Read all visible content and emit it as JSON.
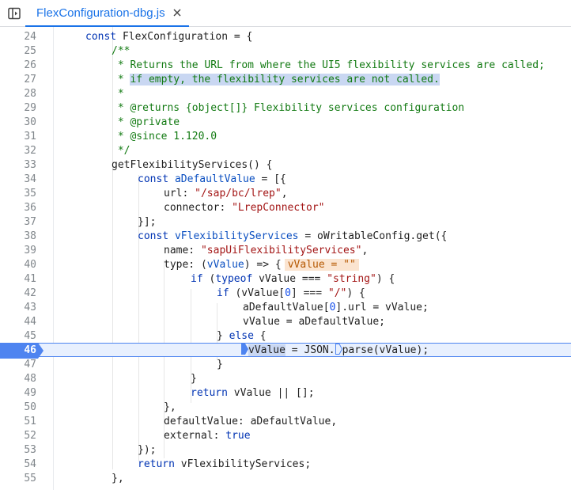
{
  "tab": {
    "filename": "FlexConfiguration-dbg.js"
  },
  "icons": {
    "sidebar_toggle": "sidebar-toggle-icon",
    "close": "close-icon",
    "breakpoint": "breakpoint-marker-icon"
  },
  "colors": {
    "accent": "#1a73e8",
    "active_line": "#e8f0fe",
    "breakpoint": "#4e84f0",
    "inline_value_bg": "#fbe4d0"
  },
  "editor": {
    "active_line": "46",
    "lines": [
      {
        "n": "24"
      },
      {
        "n": "25"
      },
      {
        "n": "26"
      },
      {
        "n": "27"
      },
      {
        "n": "28"
      },
      {
        "n": "29"
      },
      {
        "n": "30"
      },
      {
        "n": "31"
      },
      {
        "n": "32"
      },
      {
        "n": "33"
      },
      {
        "n": "34"
      },
      {
        "n": "35"
      },
      {
        "n": "36"
      },
      {
        "n": "37"
      },
      {
        "n": "38"
      },
      {
        "n": "39"
      },
      {
        "n": "40"
      },
      {
        "n": "41"
      },
      {
        "n": "42"
      },
      {
        "n": "43"
      },
      {
        "n": "44"
      },
      {
        "n": "45"
      },
      {
        "n": "46"
      },
      {
        "n": "47"
      },
      {
        "n": "48"
      },
      {
        "n": "49"
      },
      {
        "n": "50"
      },
      {
        "n": "51"
      },
      {
        "n": "52"
      },
      {
        "n": "53"
      },
      {
        "n": "54"
      },
      {
        "n": "55"
      }
    ],
    "code": {
      "l24_kw": "const",
      "l24_rest": " FlexConfiguration = {",
      "l25": "/**",
      "l26": " * Returns the URL from where the UI5 flexibility services are called;",
      "l27_star": " * ",
      "l27_sel": "if empty, the flexibility services are not called.",
      "l28": " *",
      "l29": " * @returns {object[]} Flexibility services configuration",
      "l30": " * @private",
      "l31": " * @since 1.120.0",
      "l32": " */",
      "l33": "getFlexibilityServices() {",
      "l34_kw": "const",
      "l34_decl": "aDefaultValue",
      "l34_rest": " = [{",
      "l35_key": "url: ",
      "l35_str": "\"/sap/bc/lrep\"",
      "l35_end": ",",
      "l36_key": "connector: ",
      "l36_str": "\"LrepConnector\"",
      "l37": "}];",
      "l38_kw": "const",
      "l38_decl": "vFlexibilityServices",
      "l38_rest": " = oWritableConfig.get({",
      "l39_key": "name: ",
      "l39_str": "\"sapUiFlexibilityServices\"",
      "l39_end": ",",
      "l40_key": "type: (",
      "l40_decl": "vValue",
      "l40_rest": ") => {",
      "l40_inline": "vValue = \"\"",
      "l41_kw": "if",
      "l41_a": " (",
      "l41_kw2": "typeof",
      "l41_b": " vValue === ",
      "l41_str": "\"string\"",
      "l41_c": ") {",
      "l42_kw": "if",
      "l42_a": " (vValue[",
      "l42_num": "0",
      "l42_b": "] === ",
      "l42_str": "\"/\"",
      "l42_c": ") {",
      "l43_a": "aDefaultValue[",
      "l43_num": "0",
      "l43_b": "].url = vValue;",
      "l44": "vValue = aDefaultValue;",
      "l45_a": "} ",
      "l45_kw": "else",
      "l45_b": " {",
      "l46_sel": "vValue",
      "l46_a": " = JSON.",
      "l46_b": "parse(vValue);",
      "l47": "}",
      "l48": "}",
      "l49_kw": "return",
      "l49_rest": " vValue || [];",
      "l50": "},",
      "l51": "defaultValue: aDefaultValue,",
      "l52_key": "external: ",
      "l52_kw": "true",
      "l53": "});",
      "l54_kw": "return",
      "l54_rest": " vFlexibilityServices;",
      "l55": "},"
    }
  }
}
